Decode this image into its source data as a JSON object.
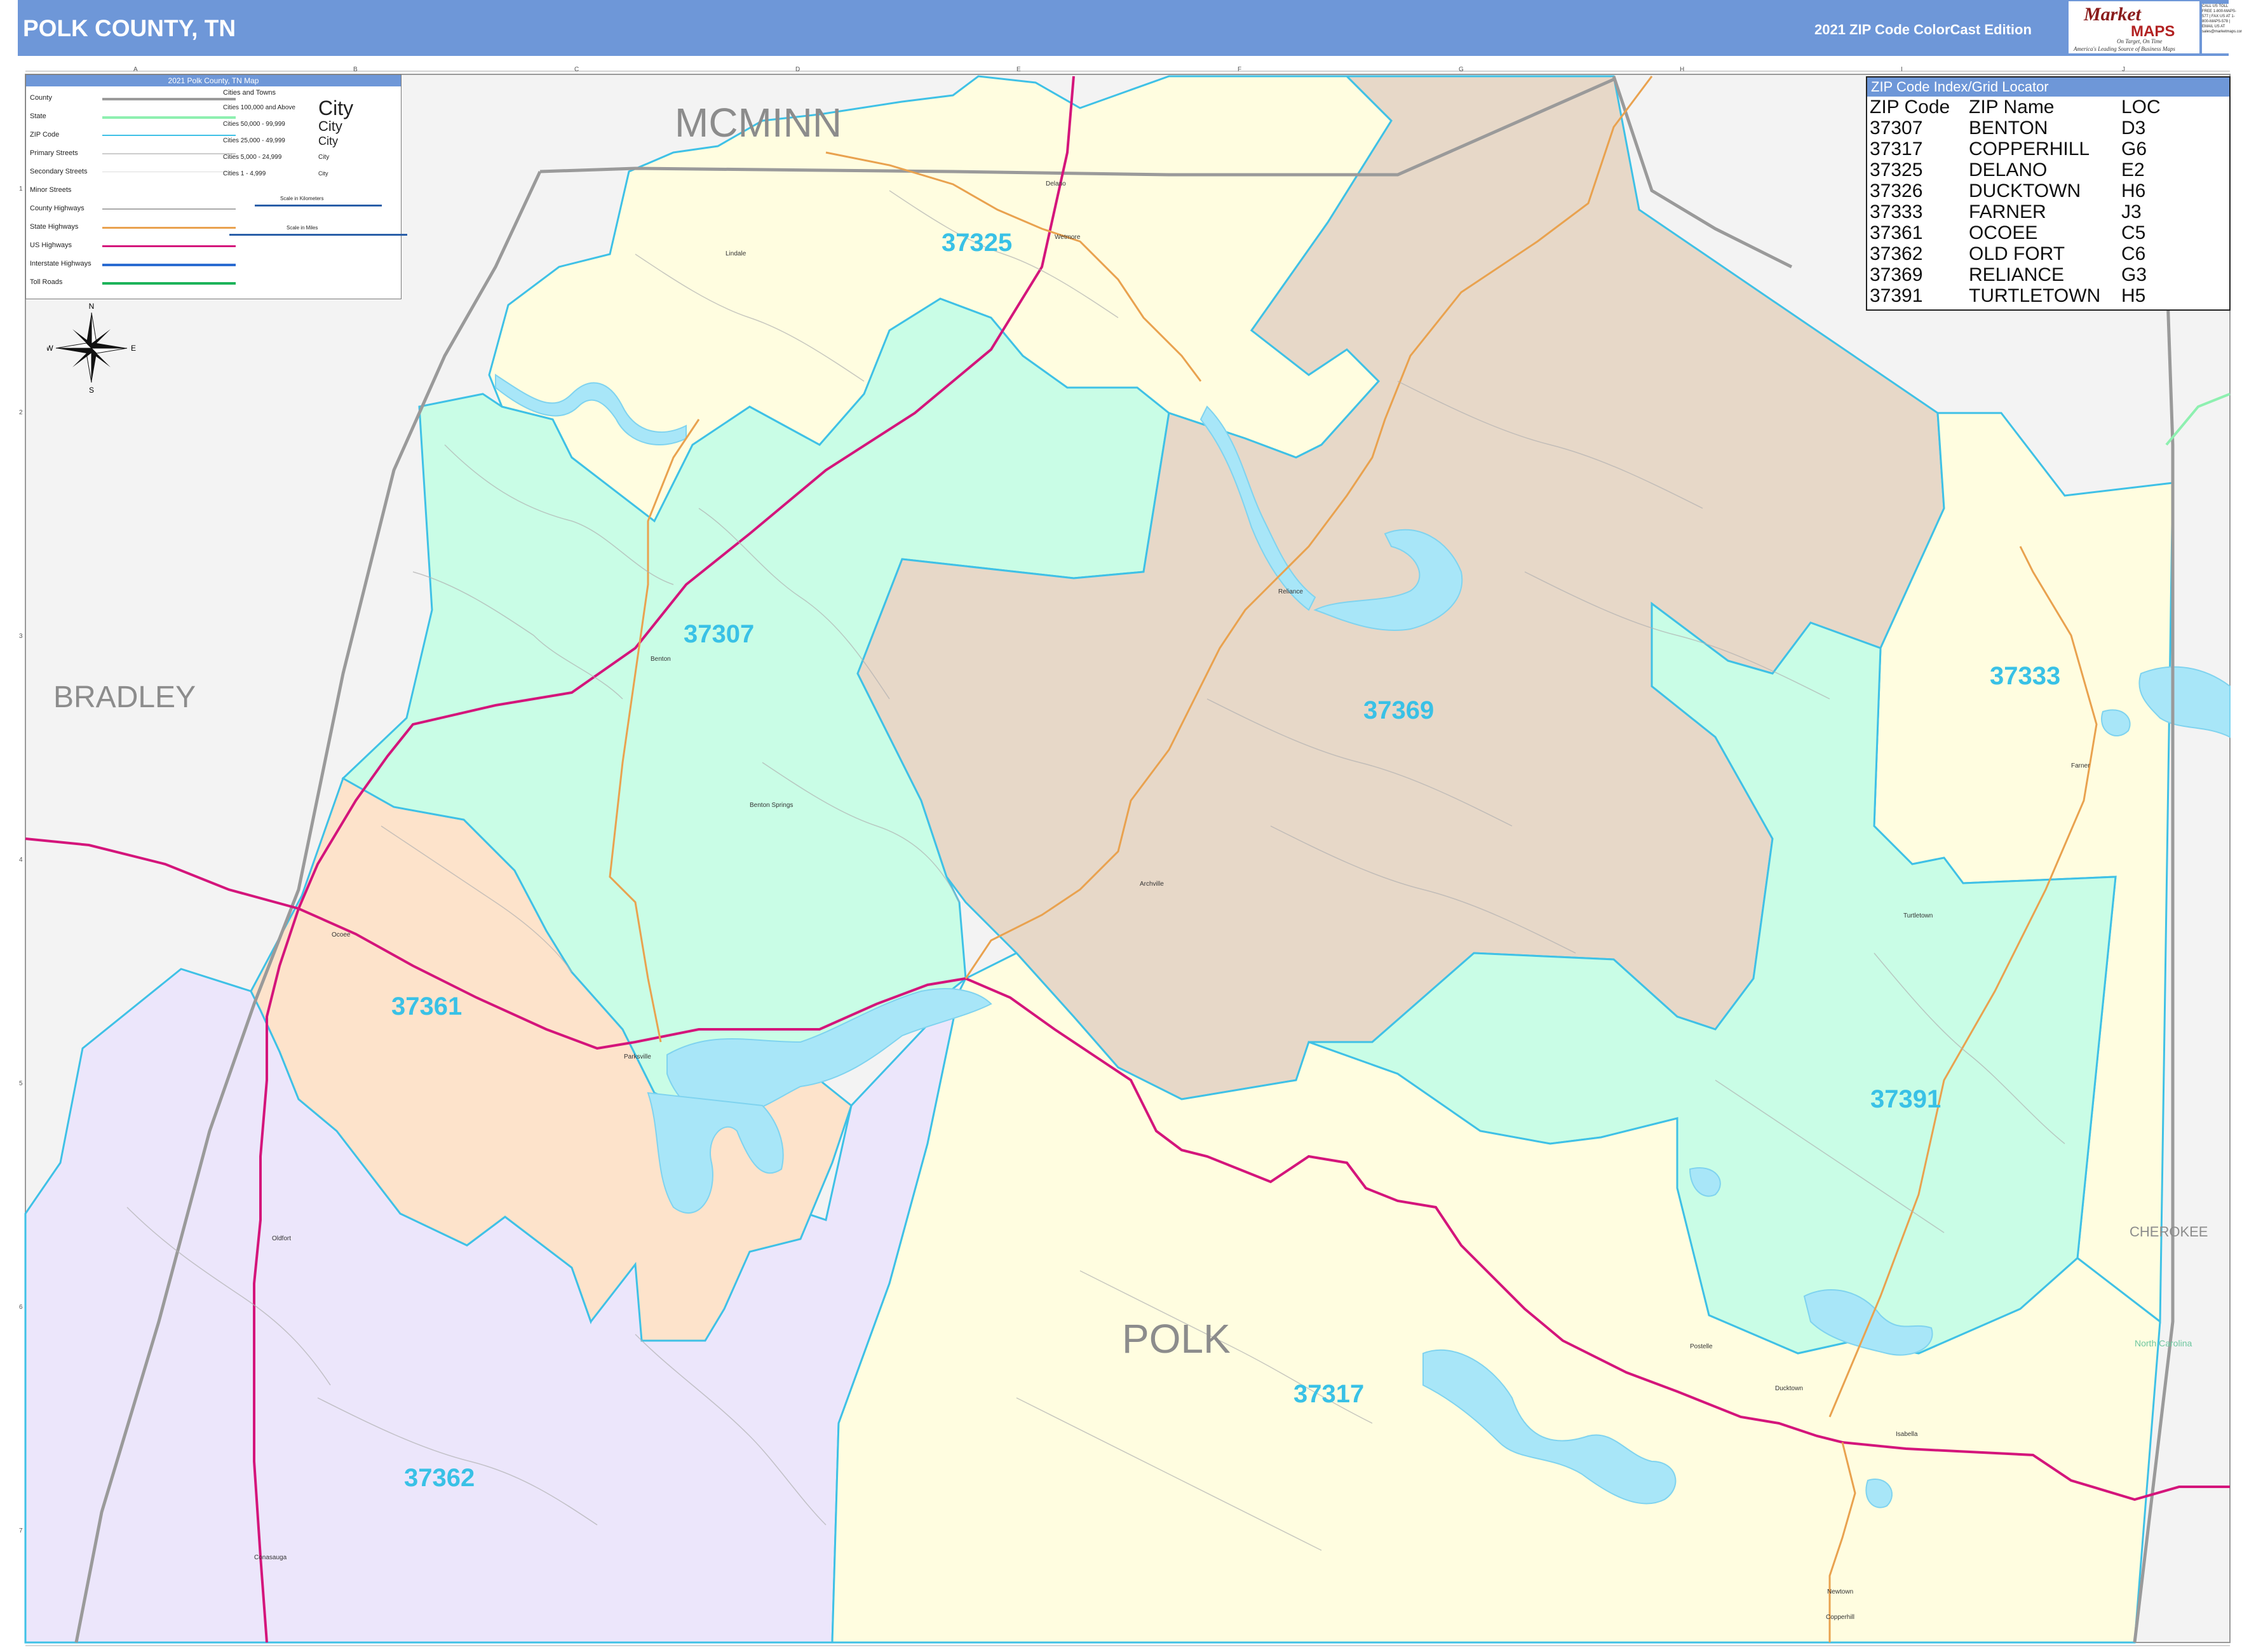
{
  "header": {
    "title": "POLK COUNTY, TN",
    "edition": "2021 ZIP Code ColorCast Edition",
    "bg_color": "#6e97d8"
  },
  "logo": {
    "brand_top": "Market",
    "brand_bottom": "MAPS",
    "tagline1": "On Target, On Time",
    "tagline2": "America's Leading Source of Business Maps",
    "contact": "CALL US TOLL FREE 1-800-MAPS-577 | FAX US AT 1-800-MAPS-578 | EMAIL US AT sales@marketmaps.com"
  },
  "legend": {
    "title": "2021 Polk County, TN Map",
    "items": [
      "County",
      "State",
      "ZIP Code",
      "Primary Streets",
      "Secondary Streets",
      "Minor Streets",
      "County Highways",
      "State Highways",
      "US Highways",
      "Interstate Highways",
      "Toll Roads"
    ],
    "cities_title": "Cities and Towns",
    "city_sizes": [
      "Cities 100,000 and Above",
      "Cities 50,000 - 99,999",
      "Cities 25,000 - 49,999",
      "Cities 5,000 - 24,999",
      "Cities 1 - 4,999"
    ],
    "city_samples": [
      "City",
      "City",
      "City",
      "City",
      "City"
    ],
    "scale_km": "Scale in Kilometers",
    "scale_mi": "Scale in Miles"
  },
  "zip_index": {
    "title": "ZIP Code Index/Grid Locator",
    "headers": [
      "ZIP Code",
      "ZIP Name",
      "LOC"
    ],
    "rows": [
      [
        "37307",
        "BENTON",
        "D3"
      ],
      [
        "37317",
        "COPPERHILL",
        "G6"
      ],
      [
        "37325",
        "DELANO",
        "E2"
      ],
      [
        "37326",
        "DUCKTOWN",
        "H6"
      ],
      [
        "37333",
        "FARNER",
        "J3"
      ],
      [
        "37361",
        "OCOEE",
        "C5"
      ],
      [
        "37362",
        "OLD FORT",
        "C6"
      ],
      [
        "37369",
        "RELIANCE",
        "G3"
      ],
      [
        "37391",
        "TURTLETOWN",
        "H5"
      ]
    ]
  },
  "compass": {
    "n": "N",
    "s": "S",
    "e": "E",
    "w": "W"
  },
  "counties": {
    "mcminn": "MCMINN",
    "bradley": "BRADLEY",
    "polk": "POLK",
    "cherokee": "CHEROKEE",
    "state_nc": "North Carolina"
  },
  "zip_labels": {
    "z37325": "37325",
    "z37307": "37307",
    "z37369": "37369",
    "z37333": "37333",
    "z37361": "37361",
    "z37391": "37391",
    "z37317": "37317",
    "z37362": "37362"
  },
  "towns": {
    "delano": "Delano",
    "wetmore": "Wetmore",
    "lindale": "Lindale",
    "benton": "Benton",
    "benton_springs": "Benton Springs",
    "reliance": "Reliance",
    "archville": "Archville",
    "ocoee": "Ocoee",
    "parksville": "Parksville",
    "farner": "Farner",
    "turtletown": "Turtletown",
    "ducktown": "Ducktown",
    "isabella": "Isabella",
    "postelle": "Postelle",
    "oldfort": "Oldfort",
    "conasauga": "Conasauga",
    "copperhill": "Copperhill",
    "newtown": "Newtown"
  },
  "grid": {
    "columns": [
      "A",
      "B",
      "C",
      "D",
      "E",
      "F",
      "G",
      "H",
      "I",
      "J"
    ],
    "rows": [
      "1",
      "2",
      "3",
      "4",
      "5",
      "6",
      "7"
    ]
  },
  "colors": {
    "z37325": "#fffde0",
    "z37307": "#c9fde6",
    "z37369": "#e7d8c8",
    "z37333": "#fffde0",
    "z37361": "#fde3cb",
    "z37391": "#c9fde6",
    "z37317": "#fffde0",
    "z37362": "#ece6fb",
    "outside": "#f3f3f3",
    "zip_border": "#3fc1e6",
    "water": "#a8e6f8",
    "us_highway": "#d4157b",
    "state_highway": "#e9a24f",
    "county_line": "#9a9a9a"
  }
}
